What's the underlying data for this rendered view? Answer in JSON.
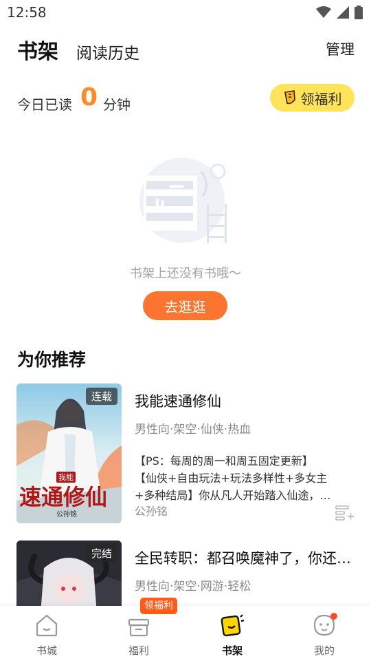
{
  "status_bar": {
    "time": "12:58"
  },
  "header": {
    "tab_shelf": "书架",
    "tab_history": "阅读历史",
    "manage": "管理"
  },
  "reading": {
    "prefix": "今日已读",
    "minutes": "0",
    "suffix": "分钟",
    "welfare_button": "领福利"
  },
  "empty_state": {
    "message": "书架上还没有书哦～",
    "browse_button": "去逛逛"
  },
  "recommend": {
    "title": "为你推荐",
    "books": [
      {
        "badge": "连载",
        "title": "我能速通修仙",
        "tags": "男性向·架空·仙侠·热血",
        "desc_line1": "【PS：每周的周一和周五固定更新】",
        "desc_line2": "【仙侠+自由玩法+玩法多样性+多女主",
        "desc_line3": "+多种结局】你从凡人开始踏入仙途，…",
        "author": "公孙铭",
        "cover_text": "速通修仙",
        "cover_small": "我能",
        "cover_author": "公孙铭"
      },
      {
        "badge": "完结",
        "title": "全民转职：都召唤魔神了，你还说…",
        "tags": "男性向·架空·网游·轻松"
      }
    ]
  },
  "bottom_nav": {
    "items": [
      {
        "label": "书城",
        "icon": "home-icon"
      },
      {
        "label": "福利",
        "icon": "gift-icon"
      },
      {
        "label": "书架",
        "icon": "bookshelf-icon"
      },
      {
        "label": "我的",
        "icon": "profile-icon"
      }
    ],
    "welfare_badge": "领福利"
  },
  "colors": {
    "accent_orange": "#fc7530",
    "reading_number": "#ff8a2c",
    "welfare_yellow": "#ffe35a",
    "badge_red": "#ff5a17"
  }
}
